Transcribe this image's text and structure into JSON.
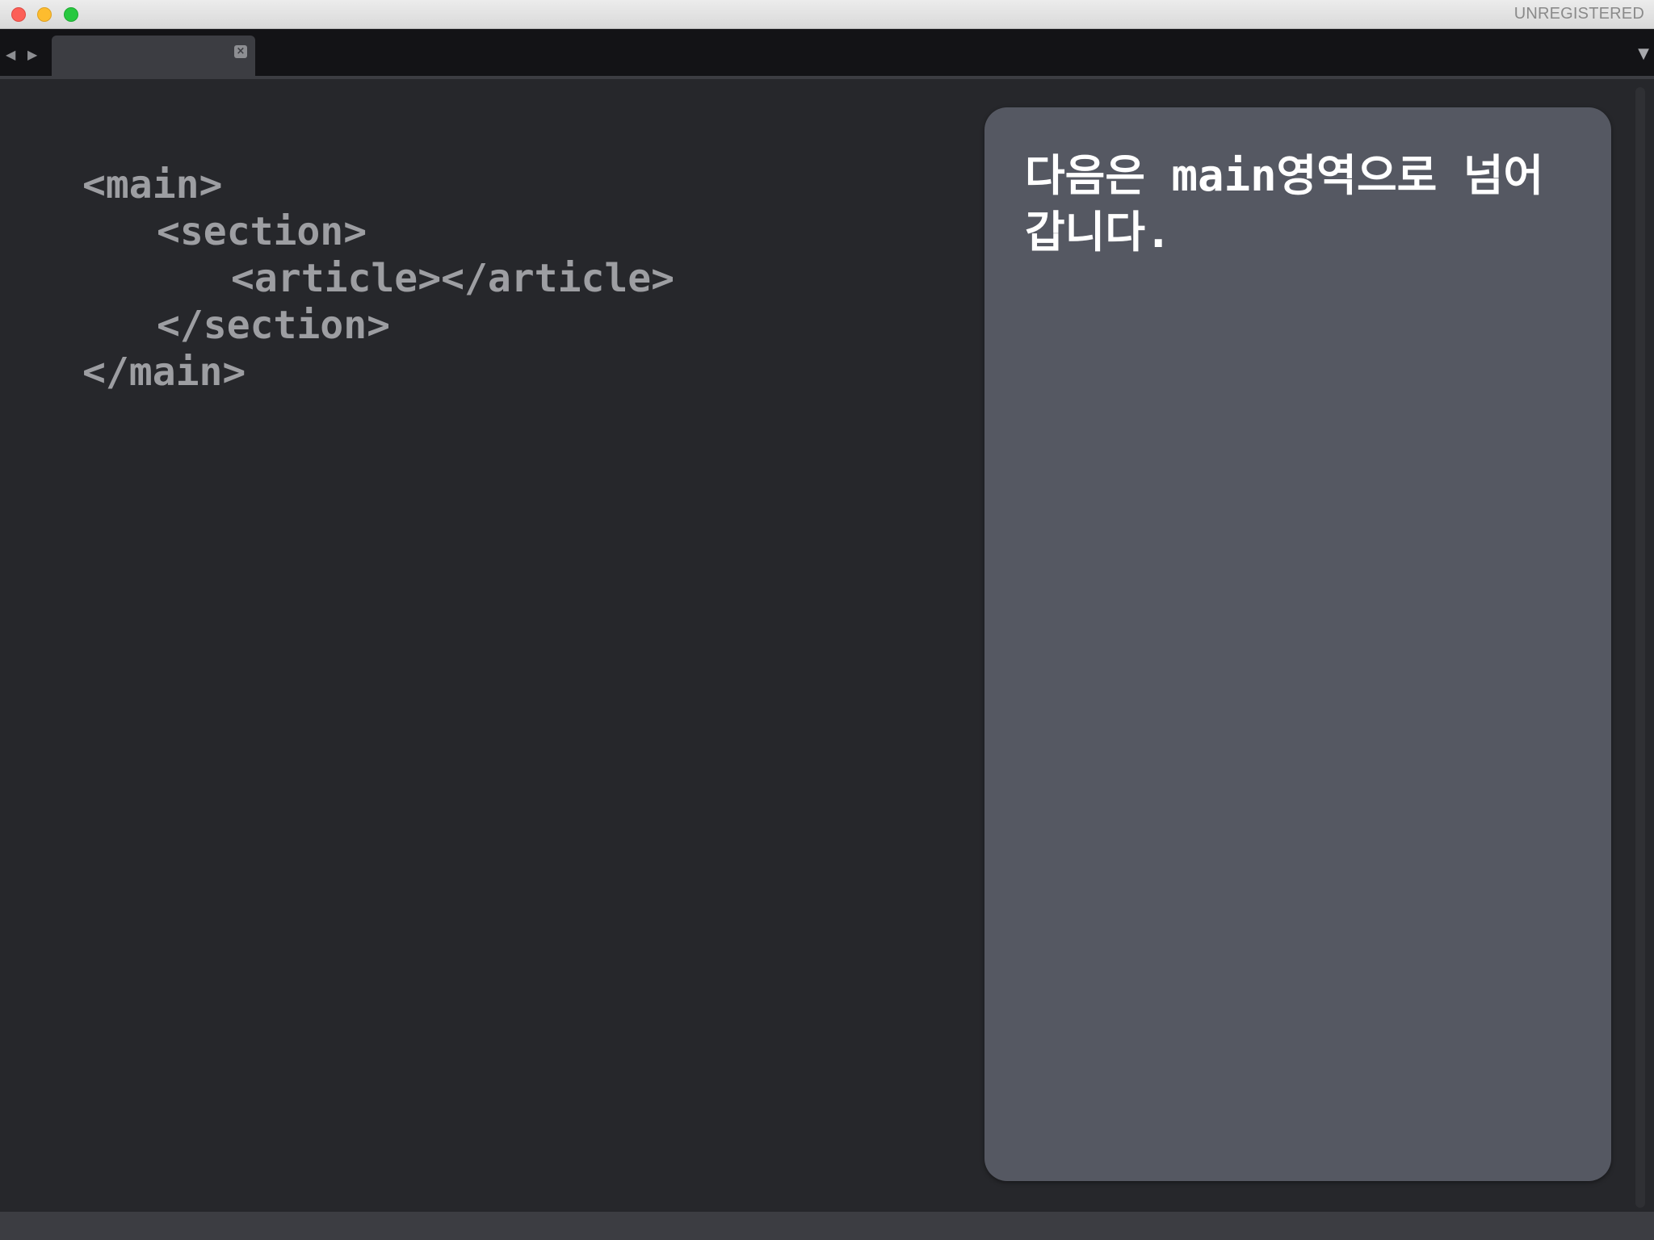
{
  "titlebar": {
    "license_label": "UNREGISTERED"
  },
  "tabbar": {
    "nav_left_icon": "triangle-left-icon",
    "nav_right_icon": "triangle-right-icon",
    "tab_close_icon": "close-icon",
    "dropdown_icon": "triangle-down-icon"
  },
  "editor": {
    "lines": [
      "<main>",
      "<section>",
      "<article></article>",
      "</section>",
      "</main>"
    ]
  },
  "note": {
    "text": "다음은 main영역으로 넘어 갑니다."
  },
  "colors": {
    "editor_bg": "#26272b",
    "note_bg": "#555862",
    "code_text": "#9d9ea2",
    "note_text": "#ffffff"
  }
}
